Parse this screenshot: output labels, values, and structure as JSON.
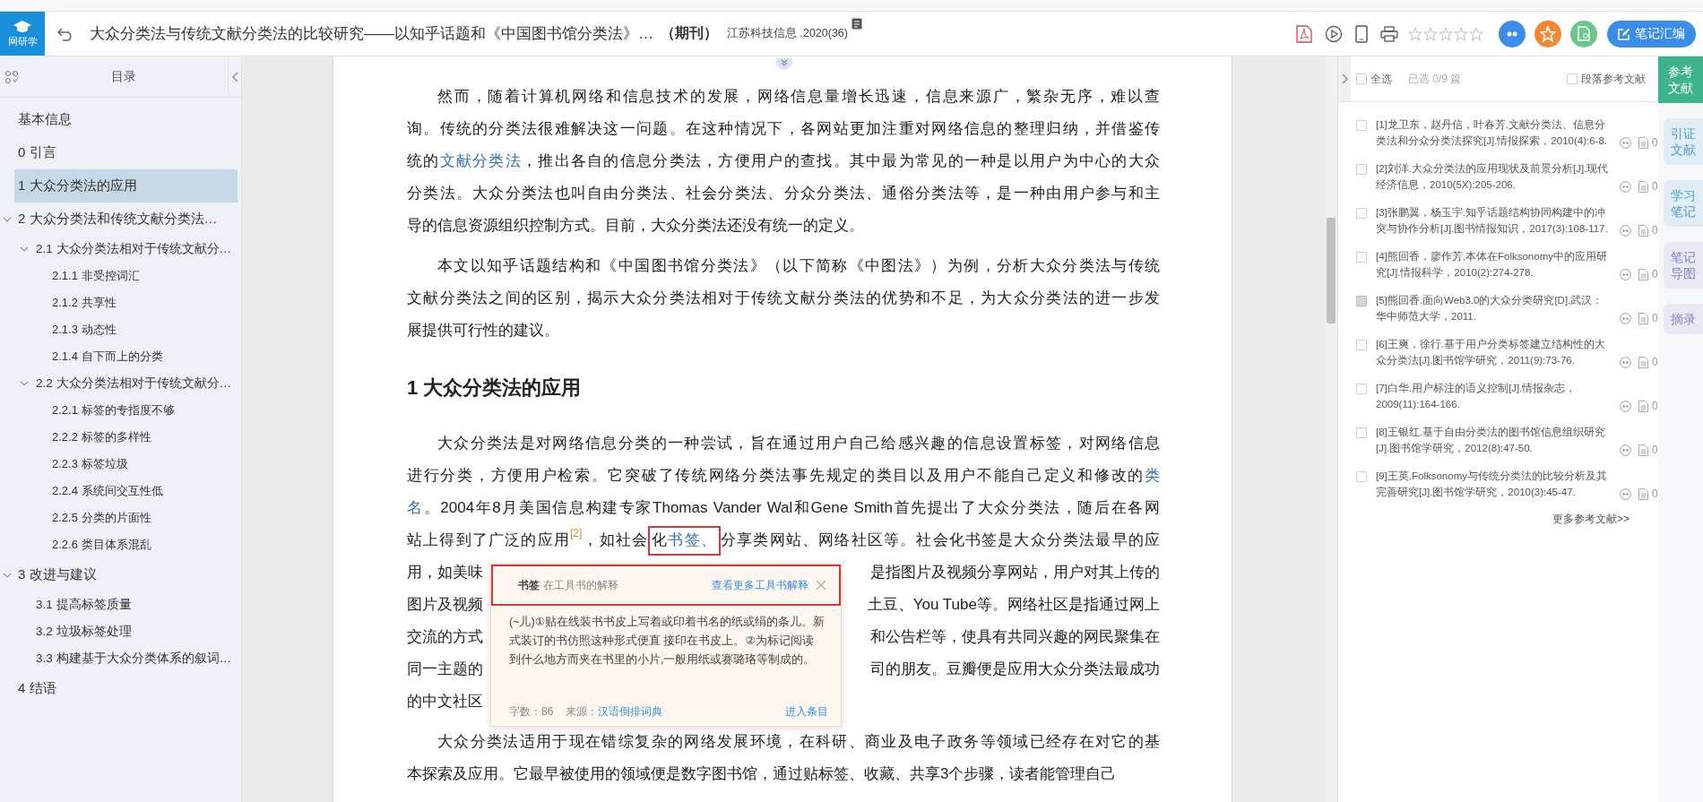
{
  "app": {
    "logo": "网研学"
  },
  "toolbar": {
    "title": "大众分类法与传统文献分类法的比较研究——以知乎话题和《中国图书馆分类法》…",
    "type_tag": "（期刊）",
    "source": "江苏科技信息 .2020(36)",
    "rating": {
      "stars": 0
    },
    "notes_button": "笔记汇编"
  },
  "toc": {
    "title": "目录",
    "items": [
      {
        "label": "基本信息",
        "selected": false
      },
      {
        "label": "0 引言",
        "selected": false
      },
      {
        "label": "1 大众分类法的应用",
        "selected": true
      },
      {
        "label": "2 大众分类法和传统文献分类法…",
        "selected": false,
        "expanded": true,
        "children": [
          {
            "label": "2.1 大众分类法相对于传统文献分…",
            "selected": false,
            "expanded": true,
            "children": [
              {
                "label": "2.1.1 非受控词汇",
                "selected": false
              },
              {
                "label": "2.1.2 共享性",
                "selected": false
              },
              {
                "label": "2.1.3 动态性",
                "selected": false
              },
              {
                "label": "2.1.4 自下而上的分类",
                "selected": false
              }
            ]
          },
          {
            "label": "2.2 大众分类法相对于传统文献分…",
            "selected": false,
            "expanded": true,
            "children": [
              {
                "label": "2.2.1 标签的专指度不够",
                "selected": false
              },
              {
                "label": "2.2.2 标签的多样性",
                "selected": false
              },
              {
                "label": "2.2.3 标签垃圾",
                "selected": false
              },
              {
                "label": "2.2.4 系统间交互性低",
                "selected": false
              },
              {
                "label": "2.2.5 分类的片面性",
                "selected": false
              },
              {
                "label": "2.2.6 类目体系混乱",
                "selected": false
              }
            ]
          }
        ]
      },
      {
        "label": "3 改进与建议",
        "selected": false,
        "expanded": true,
        "children": [
          {
            "label": "3.1 提高标签质量",
            "selected": false
          },
          {
            "label": "3.2 垃圾标签处理",
            "selected": false
          },
          {
            "label": "3.3 构建基于大众分类体系的叙词…",
            "selected": false
          }
        ]
      },
      {
        "label": "4 结语",
        "selected": false
      }
    ]
  },
  "document": {
    "blocks": [
      {
        "kind": "paragraph",
        "lines": [
          {
            "segments": [
              {
                "kind": "text",
                "text": "然而，随着计算机网络和信息技术的发展，网络信息量增长迅速，信息来源广，繁杂无序，难以查"
              }
            ]
          },
          {
            "segments": [
              {
                "kind": "text",
                "text": "询。传统的分类法很难解决这一问题。在这种情况下，各网站更加注重对网络信息的整理归纳，并借鉴传"
              }
            ]
          },
          {
            "segments": [
              {
                "kind": "text",
                "text": "统的"
              },
              {
                "kind": "link",
                "text": "文献分类法"
              },
              {
                "kind": "text",
                "text": "，推出各自的信息分类法，方便用户的查找。其中最为常见的一种是以用户为中心的大众"
              }
            ]
          },
          {
            "segments": [
              {
                "kind": "text",
                "text": "分类法。大众分类法也叫自由分类法、社会分类法、分众分类法、通俗分类法等，是一种由用户参与和主"
              }
            ]
          },
          {
            "segments": [
              {
                "kind": "text",
                "text": "导的信息资源组织控制方式。目前，大众分类法还没有统一的定义。"
              }
            ]
          }
        ]
      },
      {
        "kind": "paragraph",
        "lines": [
          {
            "segments": [
              {
                "kind": "text",
                "text": "本文以知乎话题结构和《中国图书馆分类法》（以下简称《中图法》）为例，分析大众分类法与传统"
              }
            ]
          },
          {
            "segments": [
              {
                "kind": "text",
                "text": "文献分类法之间的区别，揭示大众分类法相对于传统文献分类法的优势和不足，为大众分类法的进一步发"
              }
            ]
          },
          {
            "segments": [
              {
                "kind": "text",
                "text": "展提供可行性的建议。"
              }
            ]
          }
        ]
      },
      {
        "kind": "heading",
        "text": "1 大众分类法的应用"
      },
      {
        "kind": "paragraph",
        "lines": [
          {
            "segments": [
              {
                "kind": "text",
                "text": "大众分类法是对网络信息分类的一种尝试，旨在通过用户自己给感兴趣的信息设置标签，对网络信息"
              }
            ]
          },
          {
            "segments": [
              {
                "kind": "text",
                "text": "进行分类，方便用户检索。它突破了传统网络分类法事先规定的类目以及用户不能自己定义和修改的"
              },
              {
                "kind": "link",
                "text": "类"
              }
            ]
          },
          {
            "segments": [
              {
                "kind": "link",
                "text": "名"
              },
              {
                "kind": "text",
                "text": "。2004年8月美国信息构建专家Thomas Vander Wal和Gene Smith首先提出了大众分类法，随后在各网"
              }
            ]
          },
          {
            "segments": [
              {
                "kind": "text",
                "text": "站上得到了广泛的应用"
              },
              {
                "kind": "citation",
                "text": "[2]"
              },
              {
                "kind": "text",
                "text": "，如社会"
              },
              {
                "kind": "marked",
                "segments": [
                  {
                    "kind": "text",
                    "text": "化"
                  },
                  {
                    "kind": "link",
                    "text": "书签、"
                  }
                ]
              },
              {
                "kind": "text",
                "text": "分享类网站、网络社区等。社会化书签是大众分类法最早的应"
              }
            ]
          },
          {
            "segments": [
              {
                "kind": "text",
                "text": "用，如美味"
              }
            ],
            "right": [
              {
                "kind": "text",
                "text": "是指图片及视频分享网站，用户对其上传的"
              }
            ]
          },
          {
            "segments": [
              {
                "kind": "text",
                "text": "图片及视频"
              }
            ],
            "right": [
              {
                "kind": "text",
                "text": "土豆、You Tube等。网络社区是指通过网上"
              }
            ]
          },
          {
            "segments": [
              {
                "kind": "text",
                "text": "交流的方式"
              }
            ],
            "right": [
              {
                "kind": "text",
                "text": "和公告栏等，使具有共同兴趣的网民聚集在"
              }
            ]
          },
          {
            "segments": [
              {
                "kind": "text",
                "text": "同一主题的"
              }
            ],
            "right": [
              {
                "kind": "text",
                "text": "司的朋友。豆瓣便是应用大众分类法最成功"
              }
            ]
          },
          {
            "segments": [
              {
                "kind": "text",
                "text": "的中文社区"
              }
            ]
          }
        ],
        "popup": {
          "term": "书签",
          "subtitle": "在工具书的解释",
          "more_link": "查看更多工具书解释",
          "body": "(~儿)①贴在线装书书皮上写着或印着书名的纸或绢的条儿。新式装订的书仿照这种形式便直 接印在书皮上。②为标记阅读到什么地方而夹在书里的小片,一般用纸或赛璐珞等制成的。",
          "word_count": "字数：86",
          "source_label": "来源：",
          "source_link": "汉语倒排词典",
          "entry_link": "进入条目"
        }
      },
      {
        "kind": "paragraph",
        "lines": [
          {
            "segments": [
              {
                "kind": "text",
                "text": "大众分类法适用于现在错综复杂的网络发展环境，在科研、商业及电子政务等领域已经存在对它的基"
              }
            ]
          },
          {
            "segments": [
              {
                "kind": "text",
                "text": "本探索及应用。它最早被使用的领域便是数字图书馆，通过贴标签、收藏、共享3个步骤，读者能管理自己"
              }
            ]
          }
        ]
      }
    ]
  },
  "references": {
    "select_all": {
      "label": "全选",
      "checked": false
    },
    "selected_count": "已选 0/9 篇",
    "paragraph_refs": {
      "label": "段落参考文献",
      "checked": false
    },
    "items": [
      {
        "text": "[1]龙卫东，赵丹信，叶春芳.文献分类法、信息分类法和分众分类法探究[J].情报探索，2010(4):6-8.",
        "checked": false,
        "disabled": false,
        "count": "0"
      },
      {
        "text": "[2]刘洋.大众分类法的应用现状及前景分析[J].现代经济信息，2010(5X):205-206.",
        "checked": false,
        "disabled": false,
        "count": "0"
      },
      {
        "text": "[3]张鹏翼，杨玉宇.知乎话题结构协同构建中的冲突与协作分析[J].图书情报知识，2017(3):108-117.",
        "checked": false,
        "disabled": false,
        "count": "0"
      },
      {
        "text": "[4]熊回香，廖作芳.本体在Folksonomy中的应用研究[J].情报科学，2010(2):274-278.",
        "checked": false,
        "disabled": false,
        "count": "0"
      },
      {
        "text": "[5]熊回香.面向Web3.0的大众分类研究[D].武汉：华中师范大学，2011.",
        "checked": false,
        "disabled": true,
        "count": "0"
      },
      {
        "text": "[6]王爽，徐行.基于用户分类标签建立结构性的大众分类法[J].图书馆学研究，2011(9):73-76.",
        "checked": false,
        "disabled": false,
        "count": "0"
      },
      {
        "text": "[7]白华.用户标注的语义控制[J].情报杂志，2009(11):164-166.",
        "checked": false,
        "disabled": false,
        "count": "0"
      },
      {
        "text": "[8]王银红.基于自由分类法的图书馆信息组织研究[J].图书馆学研究，2012(8):47-50.",
        "checked": false,
        "disabled": false,
        "count": "0"
      },
      {
        "text": "[9]王英.Folksonomy与传统分类法的比较分析及其完善研究[J].图书馆学研究，2010(3):45-47.",
        "checked": false,
        "disabled": false,
        "count": "0"
      }
    ],
    "more": "更多参考文献>>"
  },
  "side_tabs": [
    {
      "label": "参考文献",
      "selected": true,
      "color": "#3db48c"
    },
    {
      "label": "引证文献",
      "selected": false,
      "color": "#4a9fd8"
    },
    {
      "label": "学习笔记",
      "selected": false,
      "color": "#4a9fd8"
    },
    {
      "label": "笔记导图",
      "selected": false,
      "color": "#7b86c4"
    },
    {
      "label": "摘录",
      "selected": false,
      "color": "#8d7fb8"
    }
  ]
}
